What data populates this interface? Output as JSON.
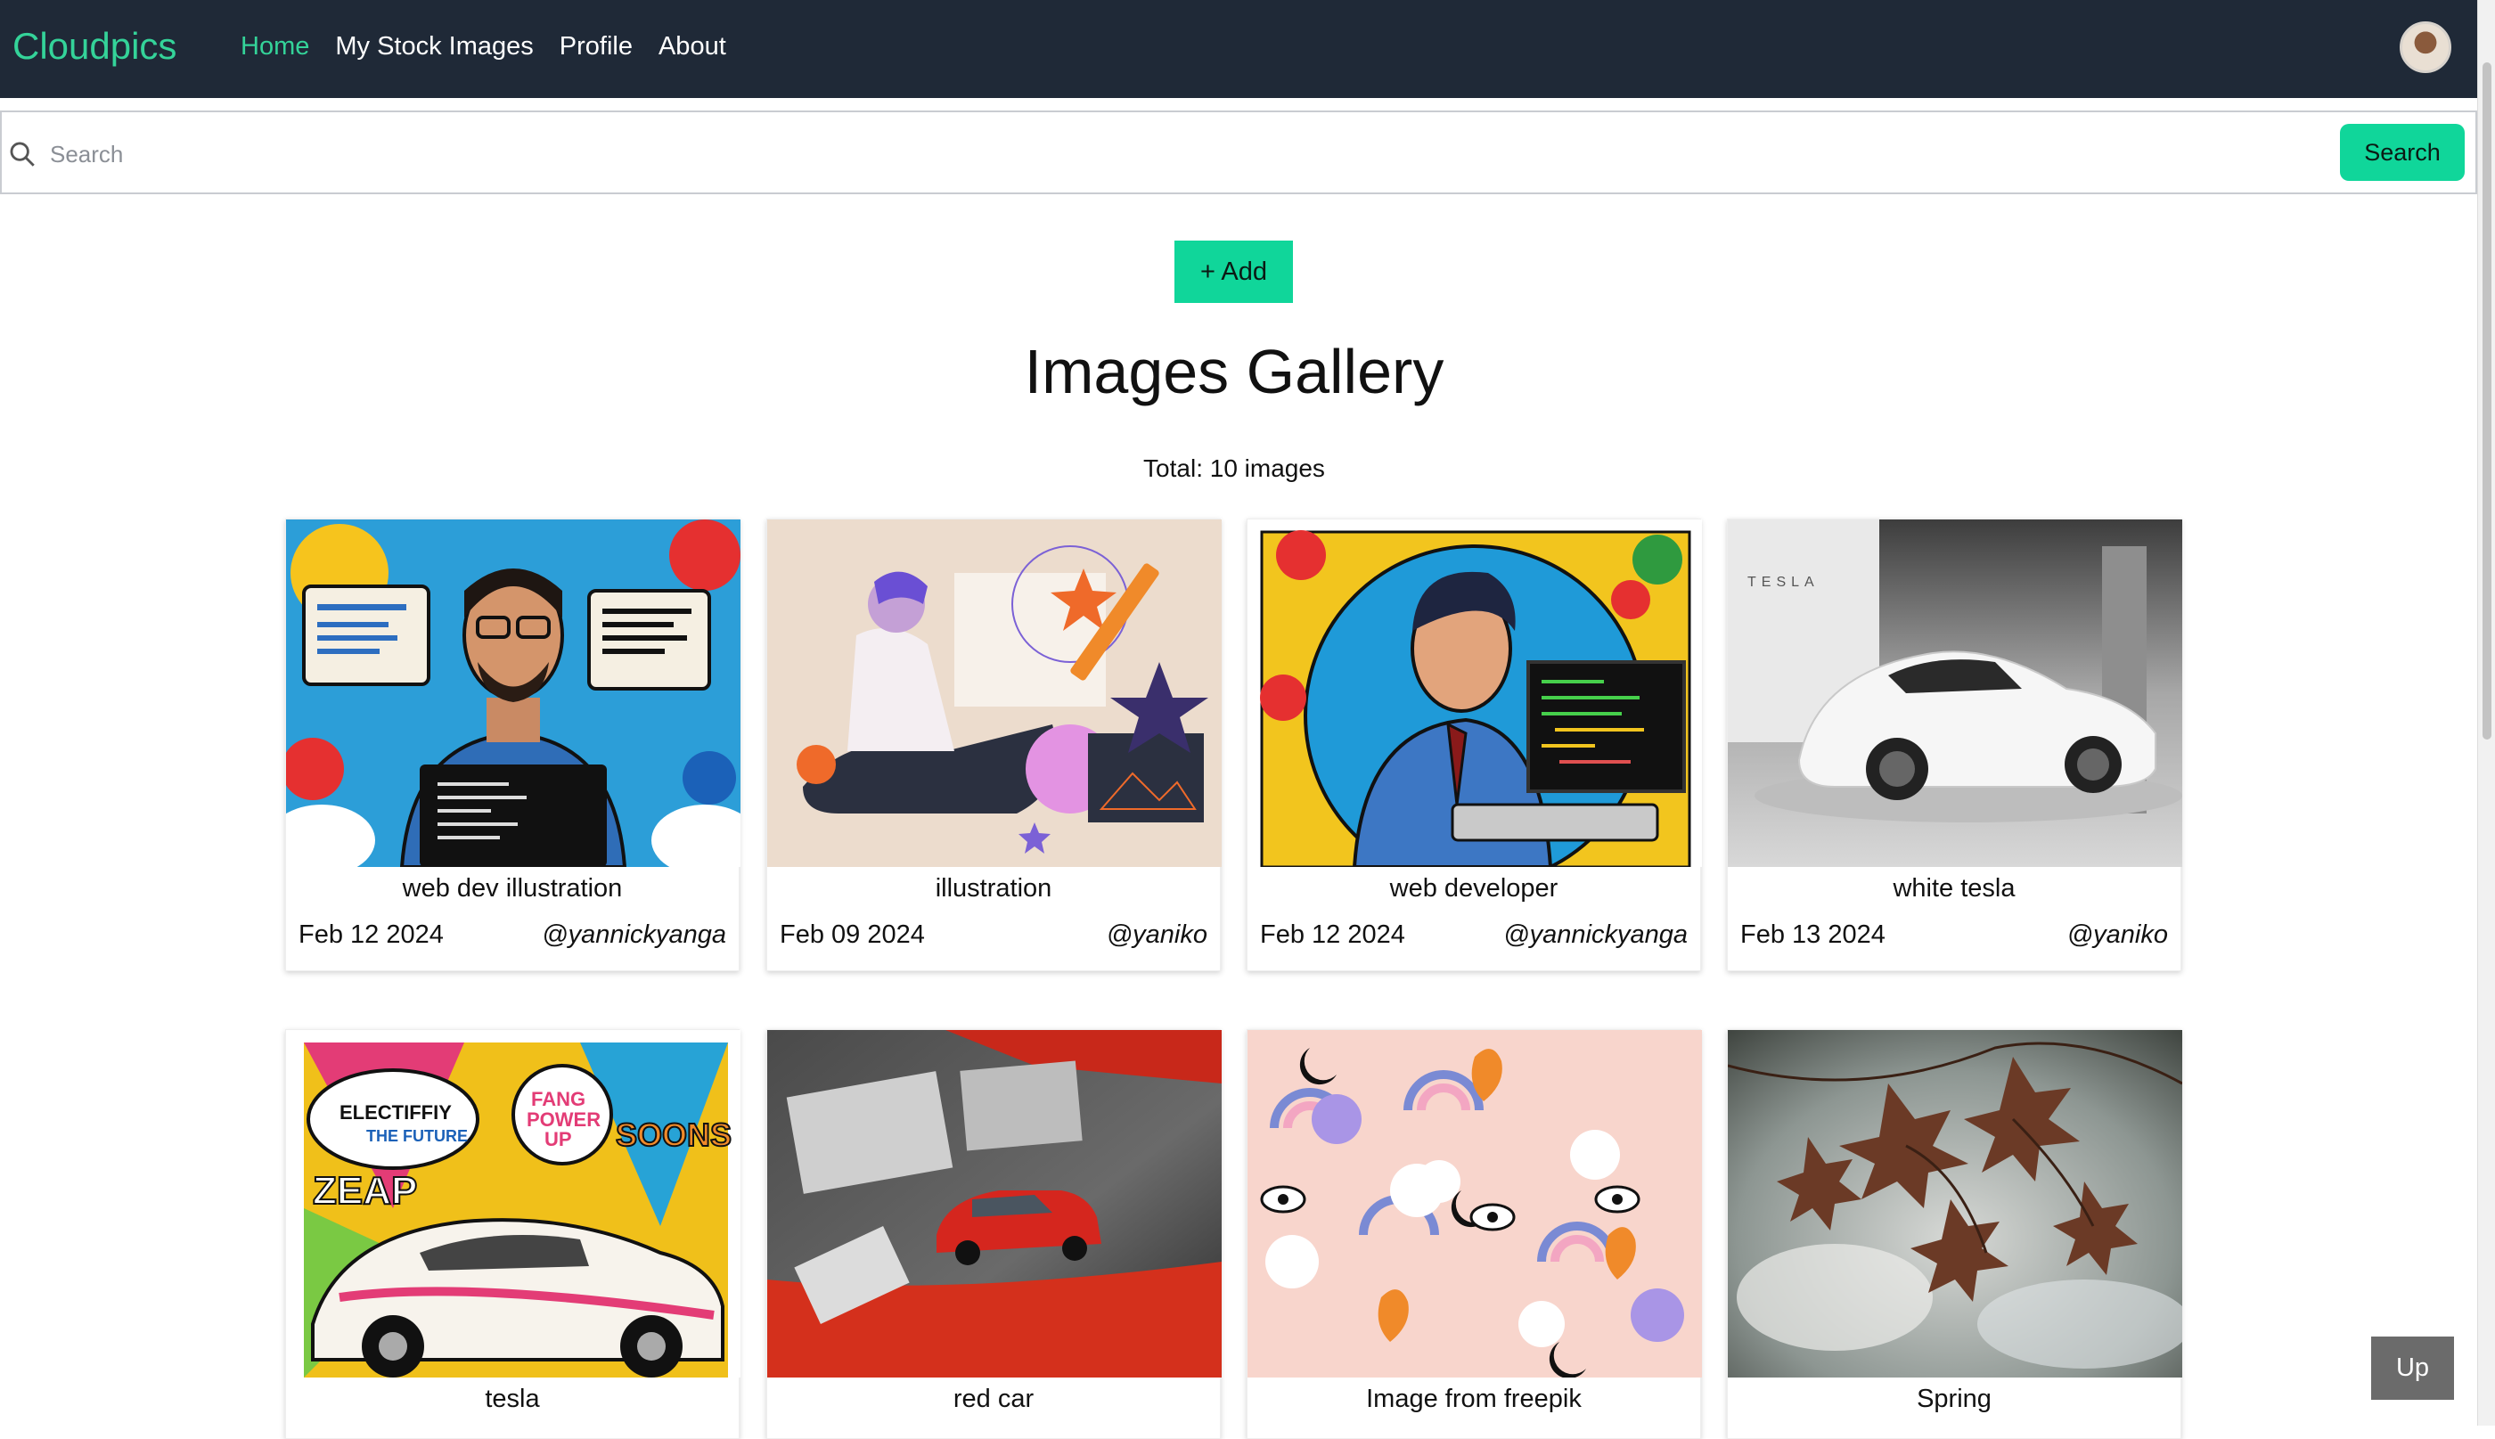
{
  "navbar": {
    "brand": "Cloudpics",
    "links": [
      {
        "label": "Home",
        "active": true
      },
      {
        "label": "My Stock Images",
        "active": false
      },
      {
        "label": "Profile",
        "active": false
      },
      {
        "label": "About",
        "active": false
      }
    ],
    "avatar_icon": "user-avatar"
  },
  "search": {
    "placeholder": "Search",
    "value": "",
    "button_label": "Search",
    "icon": "search-icon"
  },
  "actions": {
    "add_label": "+ Add",
    "up_label": "Up"
  },
  "gallery": {
    "title": "Images Gallery",
    "total_text": "Total: 10 images",
    "cards": [
      {
        "title": "web dev illustration",
        "date": "Feb 12 2024",
        "user": "@yannickyanga",
        "image": "pop-art-web-developer-with-speech-bubbles"
      },
      {
        "title": "illustration",
        "date": "Feb 09 2024",
        "user": "@yaniko",
        "image": "flat-illustration-woman-drawing"
      },
      {
        "title": "web developer",
        "date": "Feb 12 2024",
        "user": "@yannickyanga",
        "image": "pop-art-developer-at-computer"
      },
      {
        "title": "white tesla",
        "date": "Feb 13 2024",
        "user": "@yaniko",
        "image": "white-tesla-roadster-photo"
      },
      {
        "title": "tesla",
        "date": "",
        "user": "",
        "image": "pop-art-tesla-car"
      },
      {
        "title": "red car",
        "date": "",
        "user": "",
        "image": "red-toy-car-photo"
      },
      {
        "title": "Image from freepik",
        "date": "",
        "user": "",
        "image": "pink-pattern-rainbows-eyes"
      },
      {
        "title": "Spring",
        "date": "",
        "user": "",
        "image": "autumn-leaves-photo"
      }
    ]
  },
  "colors": {
    "navbar_bg": "#1f2937",
    "accent": "#10d69a",
    "brand_text": "#34d399"
  }
}
